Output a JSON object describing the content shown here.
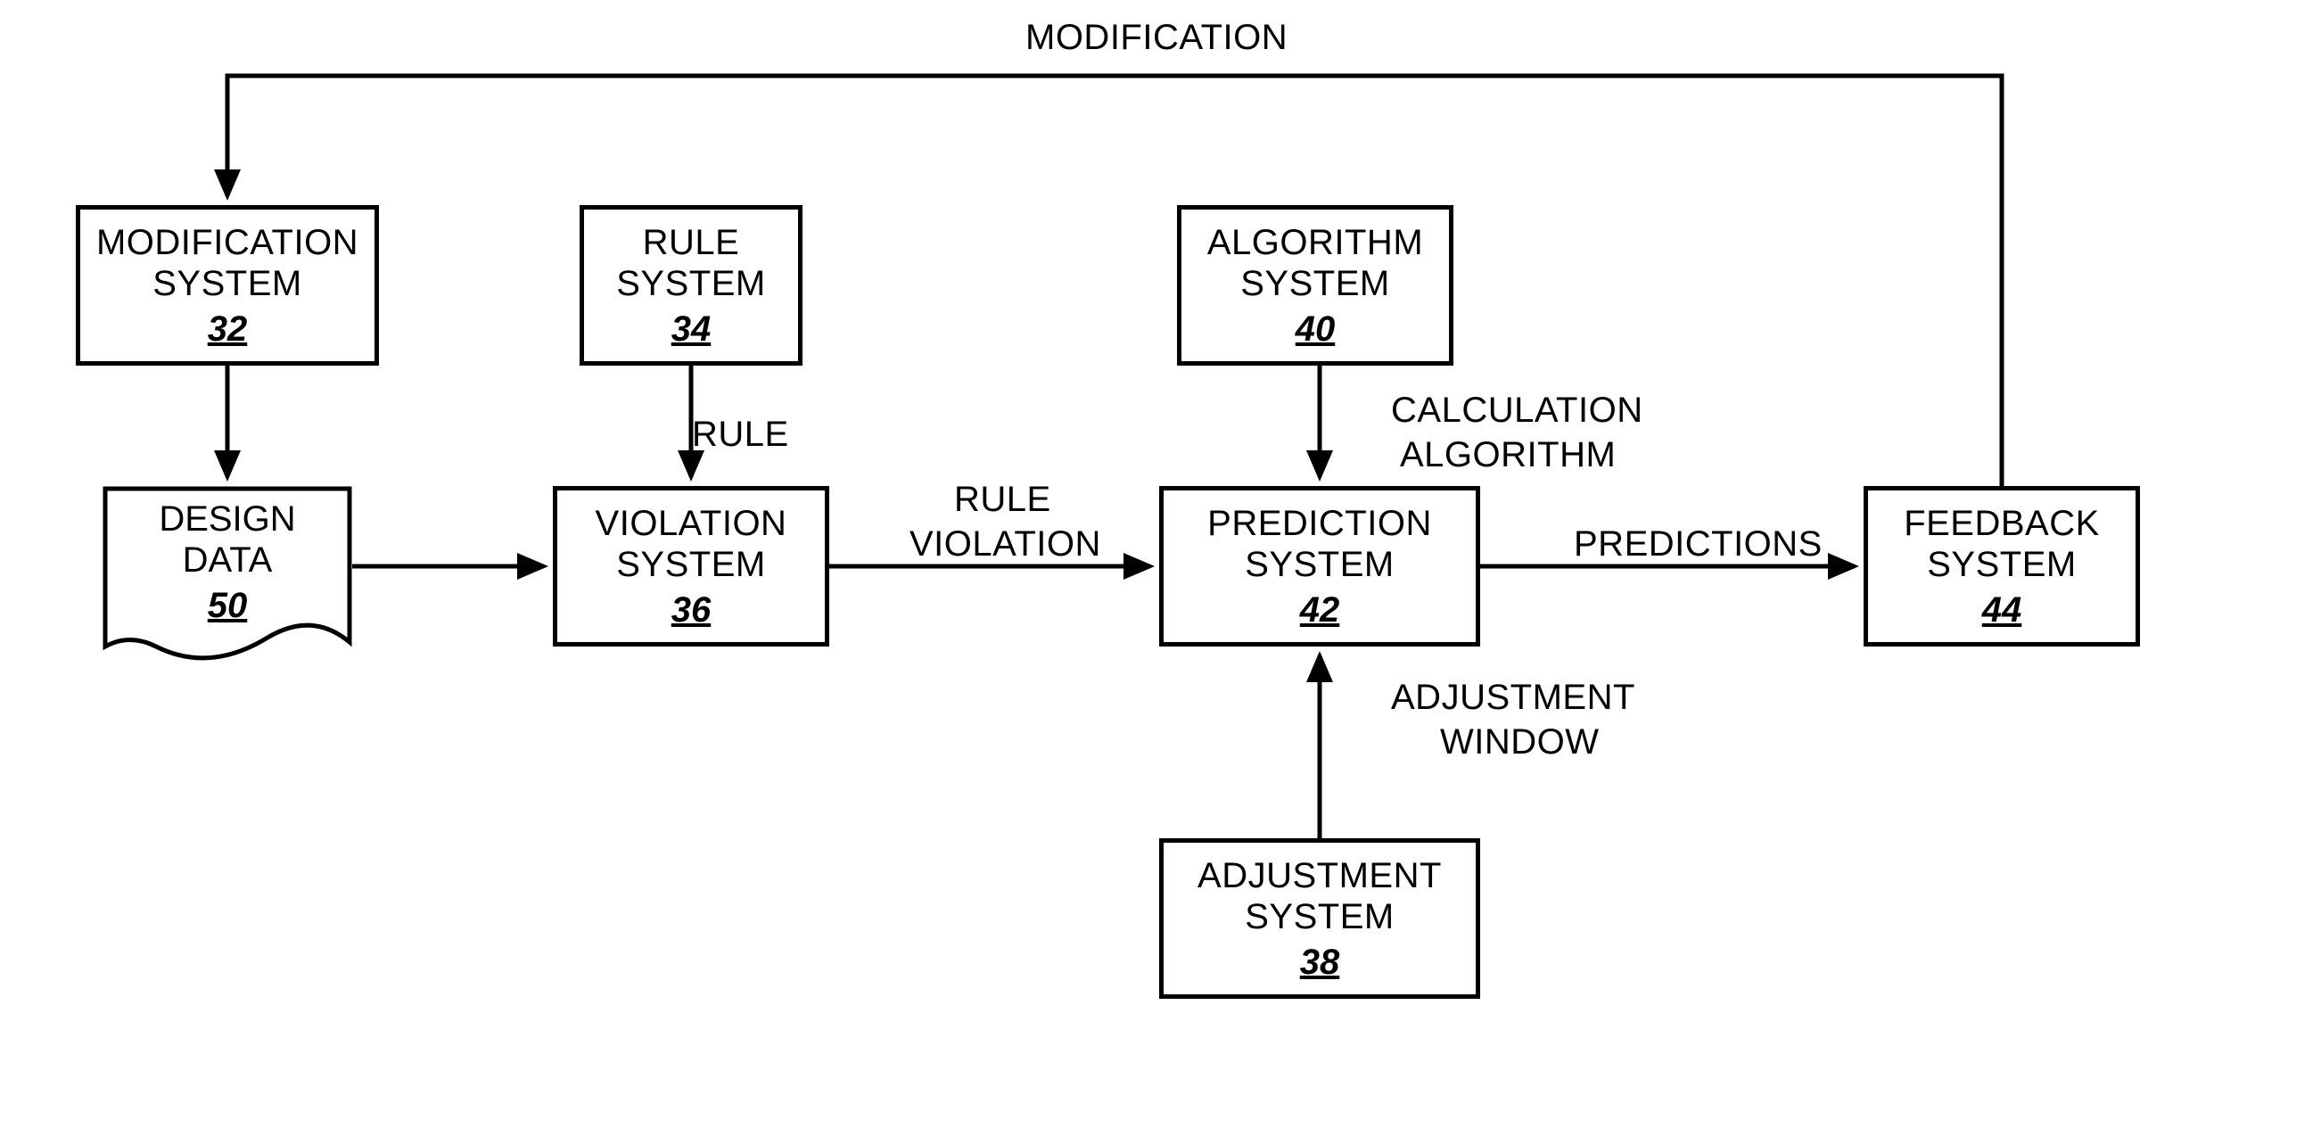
{
  "edges": {
    "modification_top": "MODIFICATION",
    "rule": "RULE",
    "rule_violation_l1": "RULE",
    "rule_violation_l2": "VIOLATION",
    "calc_alg_l1": "CALCULATION",
    "calc_alg_l2": "ALGORITHM",
    "predictions": "PREDICTIONS",
    "adj_win_l1": "ADJUSTMENT",
    "adj_win_l2": "WINDOW"
  },
  "nodes": {
    "modification_system": {
      "title_l1": "MODIFICATION",
      "title_l2": "SYSTEM",
      "ref": "32"
    },
    "rule_system": {
      "title_l1": "RULE",
      "title_l2": "SYSTEM",
      "ref": "34"
    },
    "algorithm_system": {
      "title_l1": "ALGORITHM",
      "title_l2": "SYSTEM",
      "ref": "40"
    },
    "design_data": {
      "title_l1": "DESIGN",
      "title_l2": "DATA",
      "ref": "50"
    },
    "violation_system": {
      "title_l1": "VIOLATION",
      "title_l2": "SYSTEM",
      "ref": "36"
    },
    "prediction_system": {
      "title_l1": "PREDICTION",
      "title_l2": "SYSTEM",
      "ref": "42"
    },
    "feedback_system": {
      "title_l1": "FEEDBACK",
      "title_l2": "SYSTEM",
      "ref": "44"
    },
    "adjustment_system": {
      "title_l1": "ADJUSTMENT",
      "title_l2": "SYSTEM",
      "ref": "38"
    }
  }
}
